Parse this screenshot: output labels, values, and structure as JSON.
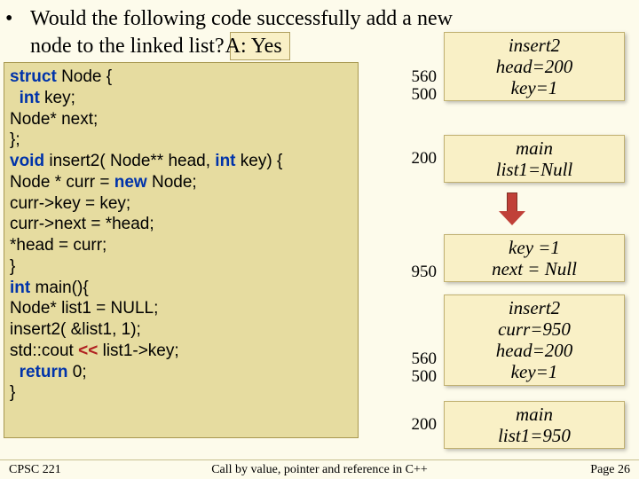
{
  "question": {
    "bullet": "•",
    "line1": "Would the following code successfully add a new",
    "line2_pre": "node to the linked list?  ",
    "answer": "A: Yes"
  },
  "code": {
    "l1_kw": "struct",
    "l1_rest": " Node {",
    "l2_kw": "int",
    "l2_rest": " key;",
    "l3": "  Node* next;",
    "l4": "};",
    "l5_kw1": "void",
    "l5_mid": " insert2( Node** head, ",
    "l5_kw2": "int",
    "l5_rest": " key) {",
    "l6_pre": "  Node * curr = ",
    "l6_kw": "new",
    "l6_rest": " Node;",
    "l7": "  curr->key  = key;",
    "l8": "  curr->next = *head;",
    "l9": "  *head = curr;",
    "l10": "}",
    "blank": " ",
    "l11_kw": "int",
    "l11_rest": " main(){",
    "l12": "  Node* list1 = NULL;",
    "l13": "  insert2( &list1, 1);",
    "l14_pre": "  std::cout ",
    "l14_op": "<<",
    "l14_rest": " list1->key;",
    "l15_kw": "return",
    "l15_rest": " 0;",
    "l16": "}"
  },
  "right": {
    "box1": {
      "l1": "insert2",
      "l2": "head=200",
      "l3": "key=1"
    },
    "box2": {
      "l1": "main",
      "l2": "list1=Null"
    },
    "box3": {
      "l1": "key =1",
      "l2": "next = Null"
    },
    "box4": {
      "l1": "insert2",
      "l2": "curr=950",
      "l3": "head=200",
      "l4": "key=1"
    },
    "box5": {
      "l1": "main",
      "l2": "list1=950"
    },
    "addr": {
      "a560_1": "560",
      "a500_1": "500",
      "a200_1": "200",
      "a950": "950",
      "a560_2": "560",
      "a500_2": "500",
      "a200_2": "200"
    }
  },
  "footer": {
    "left": "CPSC 221",
    "center": "Call by value, pointer and reference in C++",
    "right": "Page 26"
  }
}
